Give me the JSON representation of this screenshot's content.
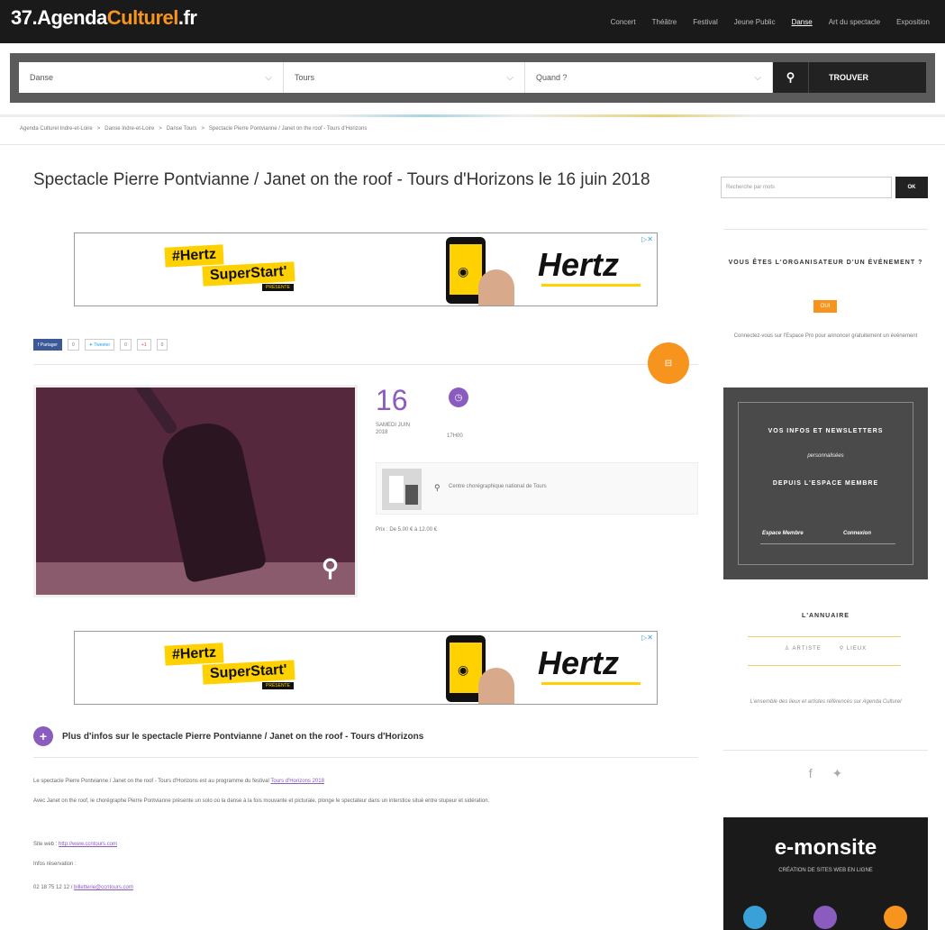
{
  "header": {
    "logo": "37.AgendaCulturel.fr",
    "nav": [
      "Concert",
      "Théâtre",
      "Festival",
      "Jeune Public",
      "Danse",
      "Art du spectacle",
      "Exposition"
    ],
    "active_nav": "Danse"
  },
  "search": {
    "category": "Danse",
    "city": "Tours",
    "when": "Quand ?",
    "find_label": "TROUVER"
  },
  "breadcrumb": [
    "Agenda Culturel Indre-et-Loire",
    "Danse Indre-et-Loire",
    "Danse Tours",
    "Spectacle Pierre Pontvianne / Janet on the roof - Tours d'Horizons"
  ],
  "event": {
    "title": "Spectacle Pierre Pontvianne / Janet on the roof - Tours d'Horizons le 16 juin 2018",
    "day": "16",
    "weekday_month": "SAMEDI JUIN 2018",
    "time": "17H00",
    "venue": "Centre chorégraphique national de Tours",
    "price": "Prix : De 5.00 € à 12.00 €"
  },
  "ads": {
    "line1": "#Hertz",
    "line2": "SuperStart'",
    "tag": "PRÉSENTE",
    "brand": "Hertz"
  },
  "social": {
    "facebook": "Partager",
    "facebook_count": "0",
    "twitter": "Tweeter",
    "twitter_count": "0",
    "gplus": "+1",
    "gplus_count": "0"
  },
  "more_info": {
    "title": "Plus d'infos sur le spectacle Pierre Pontvianne / Janet on the roof - Tours d'Horizons",
    "p1": "Le spectacle Pierre Pontvianne / Janet on the roof - Tours d'Horizons est au programme du festival",
    "p1_link": "Tours d'Horizons 2018",
    "p2": "Avec Janet on the roof, le chorégraphe Pierre Pontvianne présente un solo où la danse à la fois mouvante et picturale, plonge le spectateur dans un interstice situé entre stupeur et sidération.",
    "site_label": "Site web :",
    "site_link": "http://www.ccntours.com",
    "resa_label": "Infos réservation :",
    "resa": "02 18 75 12 12 /",
    "resa_email": "billetterie@ccntours.com"
  },
  "sidebar": {
    "search_placeholder": "Recherche par mots",
    "ok": "OK",
    "org_title": "VOUS ÊTES L'ORGANISATEUR D'UN ÉVÉNEMENT ?",
    "org_button": "OUI",
    "org_text": "Connectez-vous sur l'Espace Pro pour annoncer gratuitement un événement",
    "promo_line1": "VOS INFOS ET NEWSLETTERS",
    "promo_line2": "personnalisées",
    "promo_line3": "DEPUIS L'ESPACE MEMBRE",
    "promo_link1": "Espace Membre",
    "promo_link2": "Connexion",
    "annuaire_title": "L'ANNUAIRE",
    "annuaire_artistes": "ARTISTE",
    "annuaire_lieux": "LIEUX",
    "annuaire_text": "L'ensemble des lieux et artistes référencés sur Agenda Culturel",
    "emonsite_title": "e-monsite",
    "emonsite_sub": "CRÉATION DE SITES WEB EN LIGNE"
  },
  "colors": {
    "accent": "#8a5cbf",
    "orange": "#f7941d",
    "dark": "#1a1a1a"
  }
}
